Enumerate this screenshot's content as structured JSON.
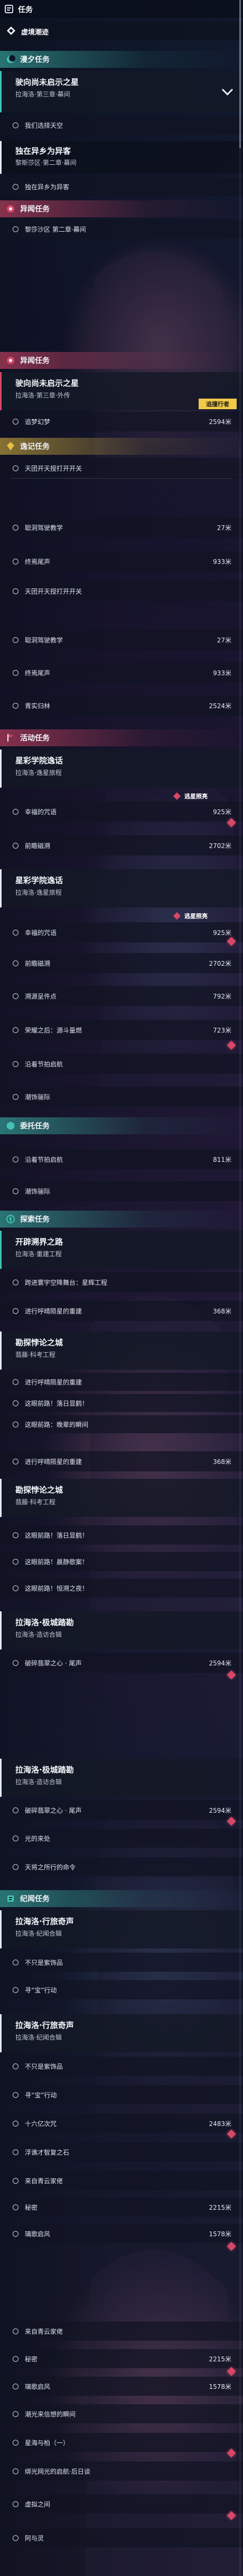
{
  "colors": {
    "teal": "#3fc4b4",
    "gold": "#e7bf42",
    "red": "#d64768",
    "white": "#f2f4f8",
    "tracking_badge": "#f0c94a"
  },
  "header": {
    "title": "任务",
    "tab_label": "虚境潮迹",
    "icon": "quest-icon"
  },
  "quests": [
    {
      "title": "驶向尚未启示之星",
      "subtitle": "拉海洛·第三章·幕间"
    },
    {
      "title": "独在异乡为异客",
      "subtitle": "黎斯莎区·第二章·幕间"
    },
    {
      "title": "驶向尚未启示之星",
      "subtitle": "拉海洛·第三章·外传"
    },
    {
      "title": "星彩学院逸话",
      "subtitle": "拉海洛·逸星旅程"
    },
    {
      "title": "星彩学院逸话",
      "subtitle": "拉海洛·逸星旅程"
    },
    {
      "title": "开辟溯界之路",
      "subtitle": "拉海洛·重建工程"
    },
    {
      "title": "勘探悖论之城",
      "subtitle": "翡藤·科考工程"
    },
    {
      "title": "勘探悖论之城",
      "subtitle": "翡藤·科考工程"
    },
    {
      "title": "拉海洛·极城踏勘",
      "subtitle": "拉海洛·造访合辑"
    },
    {
      "title": "拉海洛·极城踏勘",
      "subtitle": "拉海洛·造访合辑"
    },
    {
      "title": "拉海洛·行旅奇声",
      "subtitle": "拉海洛·纪闻合辑"
    },
    {
      "title": "拉海洛·行旅奇声",
      "subtitle": "拉海洛·纪闻合辑"
    }
  ],
  "categories": [
    {
      "label": "漫夕任务",
      "icon": "crescent-icon"
    },
    {
      "label": "异闻任务",
      "icon": "rose-icon"
    },
    {
      "label": "异闻任务",
      "icon": "rose-icon"
    },
    {
      "label": "逸记任务",
      "icon": "gem-icon"
    },
    {
      "label": "活动任务",
      "icon": "flag-icon"
    },
    {
      "label": "委托任务",
      "icon": "hex-icon"
    },
    {
      "label": "探索任务",
      "icon": "compass-icon"
    },
    {
      "label": "纪闻任务",
      "icon": "scroll-icon"
    }
  ],
  "rows": [
    {
      "label": "我们选择天空",
      "distance": ""
    },
    {
      "label": "独在异乡为异客",
      "distance": ""
    },
    {
      "label": "黎莎沙区 第二章·幕间",
      "distance": ""
    },
    {
      "label": "追梦幻梦",
      "distance": "2594米"
    },
    {
      "label": "天团开天授打开开关",
      "distance": ""
    },
    {
      "label": "聪洞驾驶教学",
      "distance": "27米"
    },
    {
      "label": "终焉尾声",
      "distance": "933米"
    },
    {
      "label": "天团开天授打开开关",
      "distance": ""
    },
    {
      "label": "聪洞驾驶教学",
      "distance": "27米"
    },
    {
      "label": "终焉尾声",
      "distance": "933米"
    },
    {
      "label": "青实归林",
      "distance": "2524米"
    },
    {
      "label": "幸福的咒语",
      "distance": "925米"
    },
    {
      "label": "前瞻磁溯",
      "distance": "2702米"
    },
    {
      "label": "幸福的咒语",
      "distance": "925米"
    },
    {
      "label": "前瞻磁溯",
      "distance": "2702米"
    },
    {
      "label": "溯源呈件点",
      "distance": "792米"
    },
    {
      "label": "荣耀之后：源斗量燃",
      "distance": "723米"
    },
    {
      "label": "沿着节拍启航",
      "distance": ""
    },
    {
      "label": "潮饰骊际",
      "distance": ""
    },
    {
      "label": "沿着节拍启航",
      "distance": "811米"
    },
    {
      "label": "潮饰骊际",
      "distance": ""
    },
    {
      "label": "跨进寰宇空降舞台：星辉工程",
      "distance": ""
    },
    {
      "label": "进行呼晴陨星的重建",
      "distance": "368米"
    },
    {
      "label": "进行呼晴陨星的重建",
      "distance": ""
    },
    {
      "label": "这眼前路！落日显鹤！",
      "distance": ""
    },
    {
      "label": "这眼前路：晚辈的瞬间",
      "distance": ""
    },
    {
      "label": "进行呼晴陨星的重建",
      "distance": "368米"
    },
    {
      "label": "这眼前路！落日显鹤！",
      "distance": ""
    },
    {
      "label": "这眼前路！晨静歌案！",
      "distance": ""
    },
    {
      "label": "这眼前路！恒溯之夜！",
      "distance": ""
    },
    {
      "label": "破碎翡翠之心 · 尾声",
      "distance": "2594米"
    },
    {
      "label": "破碎翡翠之心 · 尾声",
      "distance": "2594米"
    },
    {
      "label": "光的来处",
      "distance": ""
    },
    {
      "label": "天将之所行的命令",
      "distance": ""
    },
    {
      "label": "不只是紫饰品",
      "distance": ""
    },
    {
      "label": "寻“宝”行动",
      "distance": ""
    },
    {
      "label": "不只是紫饰品",
      "distance": ""
    },
    {
      "label": "寻“宝”行动",
      "distance": ""
    },
    {
      "label": "十六亿次咒",
      "distance": "2483米"
    },
    {
      "label": "浮谯才智复之石",
      "distance": ""
    },
    {
      "label": "来自青云家佬",
      "distance": ""
    },
    {
      "label": "秘密",
      "distance": "2215米"
    },
    {
      "label": "璃歌启风",
      "distance": "1578米"
    },
    {
      "label": "来自青云家佬",
      "distance": ""
    },
    {
      "label": "秘密",
      "distance": "2215米"
    },
    {
      "label": "璃歌启风",
      "distance": "1578米"
    },
    {
      "label": "潮光来信想的瞬间",
      "distance": ""
    },
    {
      "label": "星海与柏（一）",
      "distance": ""
    },
    {
      "label": "绑光网光的启航·后日谈",
      "distance": ""
    },
    {
      "label": "虚拟之间",
      "distance": ""
    },
    {
      "label": "阿与灵",
      "distance": ""
    }
  ],
  "badges": {
    "tracking_1": "追撞行者",
    "tracking_2": "逃星照亮",
    "tracking_3": "逃星照亮"
  }
}
